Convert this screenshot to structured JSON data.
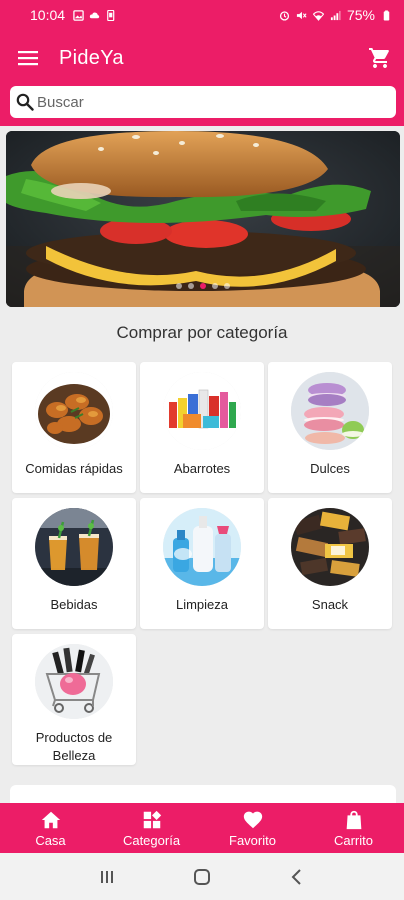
{
  "status_bar": {
    "time": "10:04",
    "battery": "75%",
    "left_icons": [
      "gallery-icon",
      "cloud-icon",
      "phone-icon"
    ],
    "right_icons": [
      "alarm-icon",
      "mute-icon",
      "wifi-icon",
      "signal-icon",
      "battery-icon"
    ]
  },
  "app_bar": {
    "title": "PideYa",
    "menu_icon": "hamburger-menu-icon",
    "cart_icon": "cart-icon"
  },
  "search": {
    "placeholder": "Buscar"
  },
  "banner": {
    "image": "burger-photo",
    "dots_count": 5,
    "active_dot": 3
  },
  "section": {
    "title": "Comprar por categoría"
  },
  "categories": [
    {
      "label": "Comidas rápidas",
      "image": "fried-chicken-photo"
    },
    {
      "label": "Abarrotes",
      "image": "groceries-photo"
    },
    {
      "label": "Dulces",
      "image": "macarons-photo"
    },
    {
      "label": "Bebidas",
      "image": "drinks-photo"
    },
    {
      "label": "Limpieza",
      "image": "cleaning-products-photo"
    },
    {
      "label": "Snack",
      "image": "snacks-photo"
    },
    {
      "label": "Productos de\nBelleza",
      "image": "beauty-products-photo"
    }
  ],
  "bottom_nav": [
    {
      "label": "Casa",
      "icon": "home-icon"
    },
    {
      "label": "Categoría",
      "icon": "category-icon"
    },
    {
      "label": "Favorito",
      "icon": "heart-icon"
    },
    {
      "label": "Carrito",
      "icon": "bag-icon"
    }
  ],
  "colors": {
    "brand": "#ec1d67",
    "background": "#ededed"
  }
}
